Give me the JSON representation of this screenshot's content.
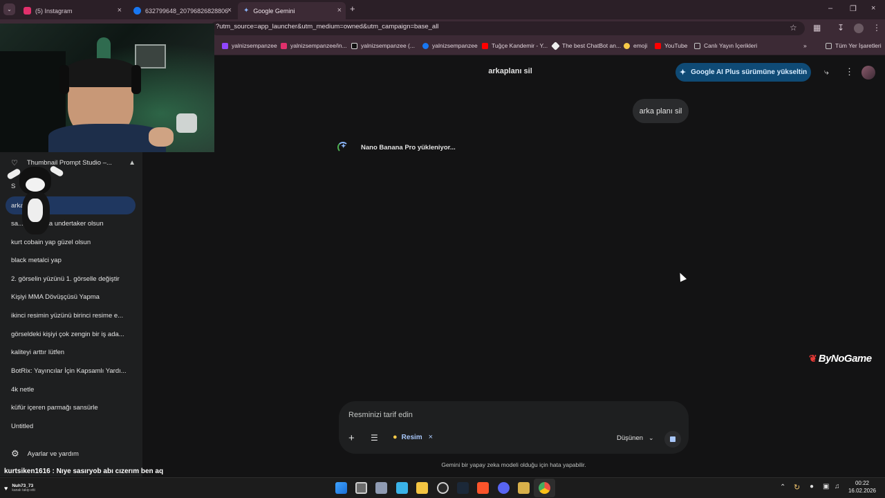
{
  "browser": {
    "tabs": [
      {
        "label": "(5) Instagram",
        "color": "#e1306c"
      },
      {
        "label": "632799648_2079682682880647",
        "color": "#1877f2"
      },
      {
        "label": "Google Gemini",
        "color": "#8ab4f8"
      }
    ],
    "url": "?utm_source=app_launcher&utm_medium=owned&utm_campaign=base_all",
    "bookmarks": [
      {
        "label": "yalnizsempanzee",
        "color": "#9146ff"
      },
      {
        "label": "yalnizsempanzee/in...",
        "color": "#e1306c"
      },
      {
        "label": "yalnizsempanzee (...",
        "color": "#ffffff"
      },
      {
        "label": "yalnizsempanzee",
        "color": "#1877f2"
      },
      {
        "label": "Tuğçe Kandemir - Y...",
        "color": "#ff0000"
      },
      {
        "label": "The best ChatBot an...",
        "color": "#ffffff"
      },
      {
        "label": "emoji",
        "color": "#f7c948"
      },
      {
        "label": "YouTube",
        "color": "#ff0000"
      },
      {
        "label": "Canlı Yayın İçerikleri",
        "color": "#c4c7c5"
      }
    ],
    "all_bookmarks": "Tüm Yer İşaretleri"
  },
  "sidebar": {
    "gem": "Thumbnail Prompt Studio –...",
    "recents": [
      "S",
      "arka planı sil",
      "sa...ap arkada undertaker olsun",
      "kurt cobain yap güzel olsun",
      "black metalci yap",
      "2. görselin yüzünü 1. görselle değiştir",
      "Kişiyi MMA Dövüşçüsü Yapma",
      "ikinci resimin yüzünü birinci resime e...",
      "görseldeki kişiyi çok zengin bir iş ada...",
      "kaliteyi arttır lütfen",
      "BotRix: Yayıncılar İçin Kapsamlı Yardı...",
      "4k netle",
      "küfür içeren parmağı sansürle",
      "Untitled"
    ],
    "settings": "Ayarlar ve yardım"
  },
  "main": {
    "title": "arkaplanı sil",
    "upgrade": "Google AI Plus sürümüne yükseltin",
    "user_message": "arka planı sil",
    "loading": "Nano Banana Pro yükleniyor...",
    "input_placeholder": "Resminizi tarif edin",
    "chip_label": "Resim",
    "mode_label": "Düşünen",
    "disclaimer": "Gemini bir yapay zeka modeli olduğu için hata yapabilir."
  },
  "stream": {
    "watermark": "ByNoGame",
    "chat_message": "kurtsiken1616 : Nıye sasıryob abı cızerım ben aq",
    "follower_name": "Nuh73_73",
    "follower_sub": "kanalı takip etti"
  },
  "taskbar": {
    "time": "00:22",
    "date": "16.02.2026"
  },
  "colors": {
    "accent_blue": "#0f4a75",
    "active_chat": "#1f3760",
    "page_bg": "#131314"
  }
}
